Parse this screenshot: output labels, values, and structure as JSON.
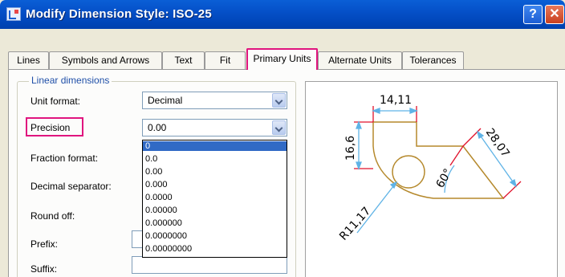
{
  "window": {
    "title": "Modify Dimension Style: ISO-25",
    "help_label": "?",
    "close_label": "✕"
  },
  "tabs": [
    {
      "label": "Lines"
    },
    {
      "label": "Symbols and Arrows"
    },
    {
      "label": "Text"
    },
    {
      "label": "Fit"
    },
    {
      "label": "Primary Units",
      "active": true
    },
    {
      "label": "Alternate Units"
    },
    {
      "label": "Tolerances"
    }
  ],
  "linear_dimensions": {
    "legend": "Linear dimensions",
    "unit_format_label": "Unit format:",
    "unit_format_value": "Decimal",
    "precision_label": "Precision",
    "precision_value": "0.00",
    "fraction_format_label": "Fraction format:",
    "decimal_separator_label": "Decimal separator:",
    "round_off_label": "Round off:",
    "prefix_label": "Prefix:",
    "suffix_label": "Suffix:"
  },
  "precision_options": [
    "0",
    "0.0",
    "0.00",
    "0.000",
    "0.0000",
    "0.00000",
    "0.000000",
    "0.0000000",
    "0.00000000"
  ],
  "precision_selected_index": 0,
  "preview": {
    "dim_top": "14,11",
    "dim_left": "16,6",
    "dim_angle": "60°",
    "dim_diag": "28,07",
    "dim_radius": "R11,17"
  },
  "colors": {
    "highlight_outline": "#e0157e",
    "title_bar": "#0550c8",
    "selection": "#316ac5",
    "extension_line": "#e0102a",
    "dimension_line": "#5fb3e6",
    "geometry_line": "#b5892c"
  }
}
